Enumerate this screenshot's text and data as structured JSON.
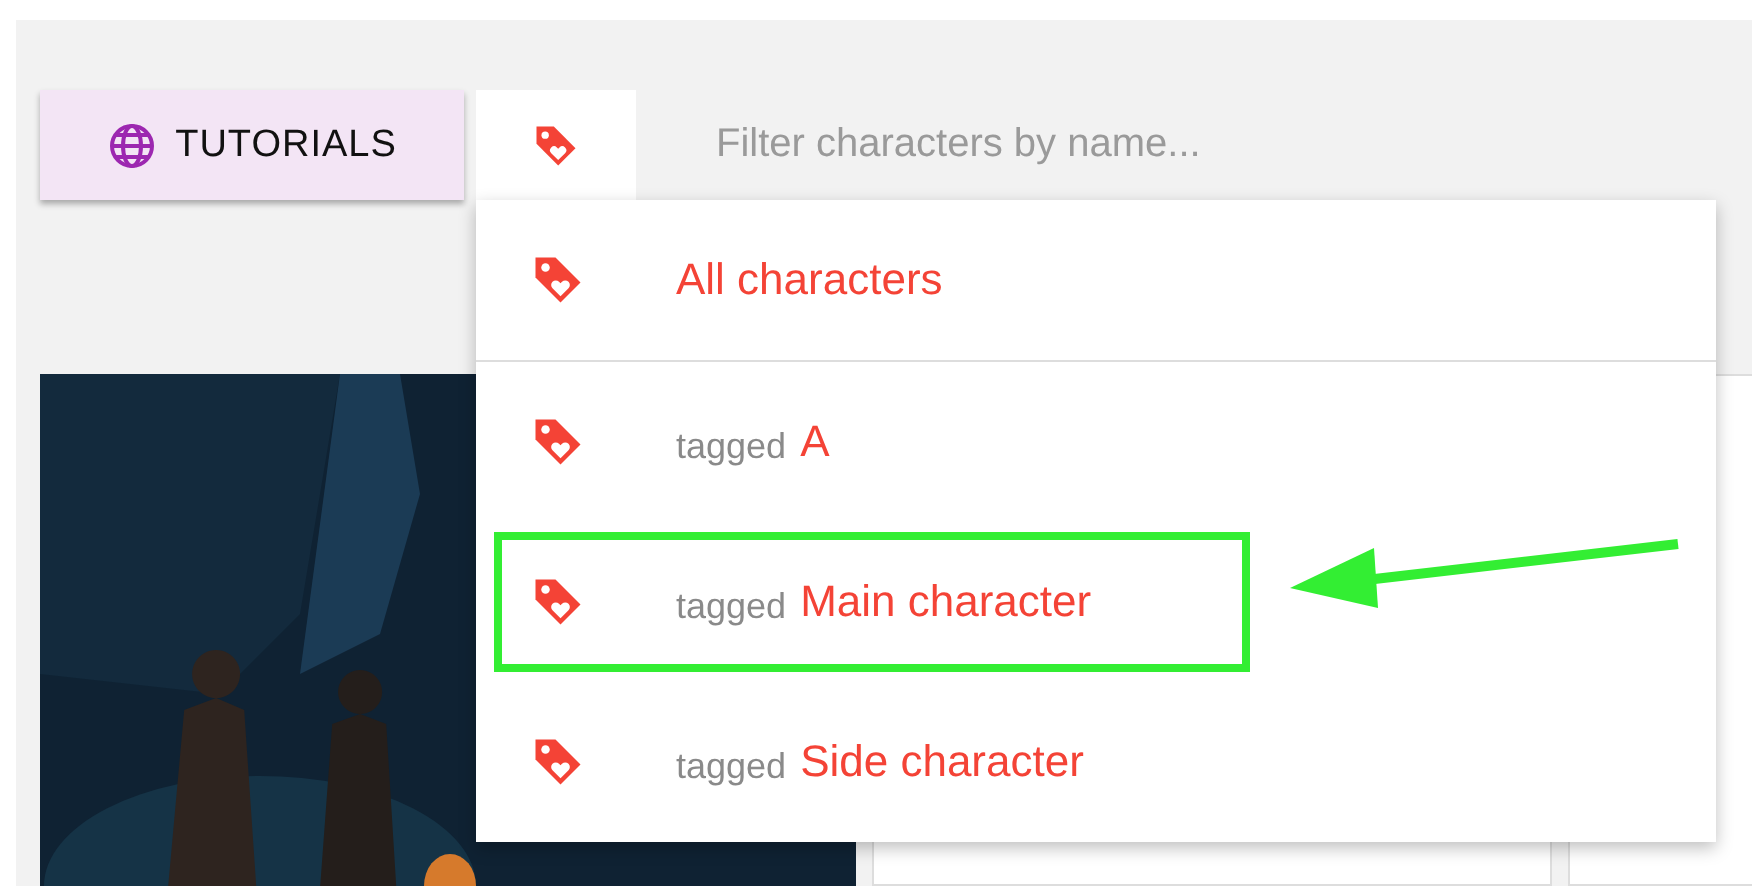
{
  "toolbar": {
    "tutorials_button": "TUTORIALS",
    "search": {
      "placeholder": "Filter characters by name..."
    }
  },
  "tag_menu": {
    "open": true,
    "items": [
      {
        "kind": "all",
        "label": "All characters",
        "highlighted": false
      },
      {
        "kind": "tagged",
        "prefix": "tagged",
        "label": "A",
        "highlighted": false
      },
      {
        "kind": "tagged",
        "prefix": "tagged",
        "label": "Main character",
        "highlighted": true
      },
      {
        "kind": "tagged",
        "prefix": "tagged",
        "label": "Side character",
        "highlighted": false
      }
    ]
  },
  "cards": [
    {
      "kind": "picture"
    },
    {
      "kind": "blank"
    },
    {
      "kind": "blank"
    }
  ]
}
